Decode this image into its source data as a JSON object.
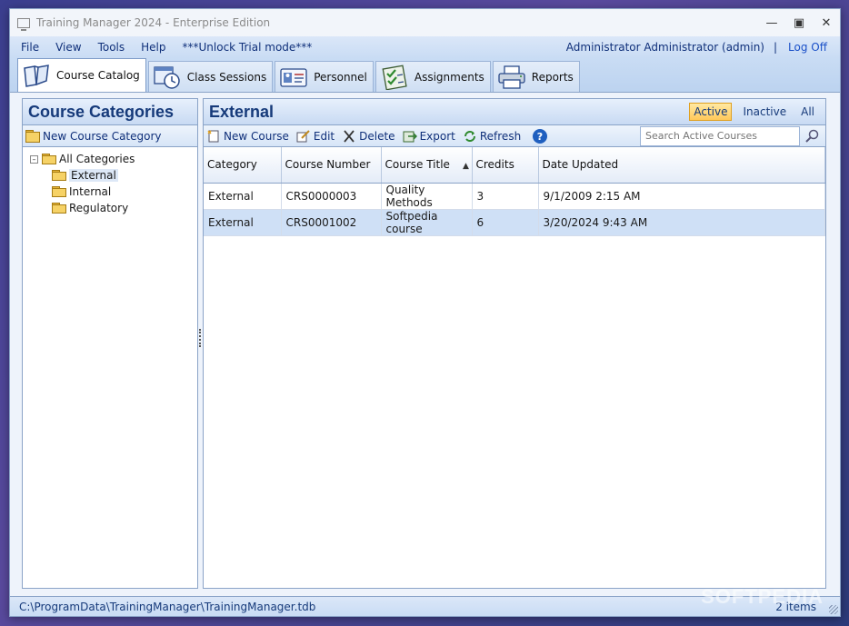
{
  "window": {
    "title": "Training Manager 2024 - Enterprise Edition"
  },
  "menu": {
    "items": [
      "File",
      "View",
      "Tools",
      "Help",
      "***Unlock Trial mode***"
    ],
    "user": "Administrator Administrator (admin)",
    "separator": "|",
    "logoff": "Log Off"
  },
  "tabs": [
    {
      "label": "Course Catalog",
      "icon": "book-icon"
    },
    {
      "label": "Class Sessions",
      "icon": "clock-calendar-icon"
    },
    {
      "label": "Personnel",
      "icon": "id-card-icon"
    },
    {
      "label": "Assignments",
      "icon": "checklist-icon"
    },
    {
      "label": "Reports",
      "icon": "printer-icon"
    }
  ],
  "left": {
    "title": "Course Categories",
    "new_category": "New Course Category",
    "tree_root": "All Categories",
    "tree_children": [
      "External",
      "Internal",
      "Regulatory"
    ]
  },
  "right": {
    "title": "External",
    "filters": {
      "active": "Active",
      "inactive": "Inactive",
      "all": "All"
    },
    "toolbar": {
      "new_course": "New Course",
      "edit": "Edit",
      "delete": "Delete",
      "export": "Export",
      "refresh": "Refresh"
    },
    "search_placeholder": "Search Active Courses",
    "columns": [
      "Category",
      "Course Number",
      "Course Title",
      "Credits",
      "Date Updated"
    ],
    "rows": [
      [
        "External",
        "CRS0000003",
        "Quality Methods",
        "3",
        "9/1/2009 2:15 AM"
      ],
      [
        "External",
        "CRS0001002",
        "Softpedia course",
        "6",
        "3/20/2024 9:43 AM"
      ]
    ]
  },
  "status": {
    "path": "C:\\ProgramData\\TrainingManager\\TrainingManager.tdb",
    "count": "2 items"
  },
  "watermark": "SOFTPEDIA",
  "colors": {
    "accent": "#163a7a",
    "active_filter": "#ffc85a",
    "selected_row": "#cfe0f6"
  }
}
